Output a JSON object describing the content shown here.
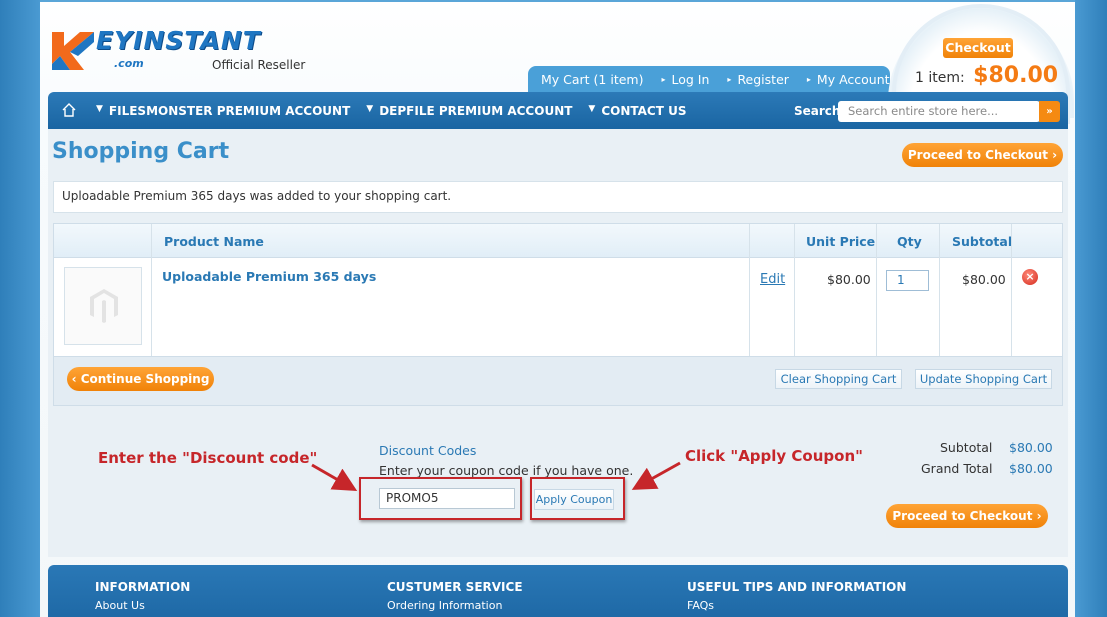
{
  "header": {
    "logo_text": "EYINSTANT",
    "logo_com": ".com",
    "official_reseller": "Official Reseller",
    "tabs": [
      {
        "label": "My Cart (1 item)"
      },
      {
        "label": "Log In"
      },
      {
        "label": "Register"
      },
      {
        "label": "My Account"
      }
    ],
    "checkout_label": "Checkout",
    "cart_count": "1 item:",
    "cart_total": "$80.00"
  },
  "nav": {
    "items": [
      {
        "label": "FILESMONSTER PREMIUM ACCOUNT"
      },
      {
        "label": "DEPFILE PREMIUM ACCOUNT"
      },
      {
        "label": "CONTACT US"
      }
    ],
    "search_label": "Search:",
    "search_placeholder": "Search entire store here...",
    "search_button": "»"
  },
  "page": {
    "title": "Shopping Cart",
    "proceed_label": "Proceed to Checkout",
    "message": "Uploadable Premium 365 days was added to your shopping cart."
  },
  "cart_table": {
    "headers": {
      "product": "Product Name",
      "unit_price": "Unit Price",
      "qty": "Qty",
      "subtotal": "Subtotal"
    },
    "rows": [
      {
        "name": "Uploadable Premium 365 days",
        "edit": "Edit",
        "unit_price": "$80.00",
        "qty": "1",
        "subtotal": "$80.00",
        "remove": "×"
      }
    ],
    "continue_label": "Continue Shopping",
    "clear_label": "Clear Shopping Cart",
    "update_label": "Update Shopping Cart"
  },
  "discount": {
    "title": "Discount Codes",
    "help": "Enter your coupon code if you have one.",
    "code_value": "PROMO5",
    "apply_label": "Apply Coupon",
    "annotation_enter": "Enter the \"Discount code\"",
    "annotation_click": "Click \"Apply Coupon\""
  },
  "totals": {
    "subtotal_label": "Subtotal",
    "subtotal_value": "$80.00",
    "grand_label": "Grand Total",
    "grand_value": "$80.00"
  },
  "footer": {
    "columns": [
      {
        "heading": "INFORMATION",
        "link": "About Us"
      },
      {
        "heading": "CUSTUMER SERVICE",
        "link": "Ordering Information"
      },
      {
        "heading": "USEFUL TIPS AND INFORMATION",
        "link": "FAQs"
      }
    ]
  },
  "colors": {
    "accent_blue": "#2a79b4",
    "orange": "#f08208",
    "annotation_red": "#c6262a"
  }
}
